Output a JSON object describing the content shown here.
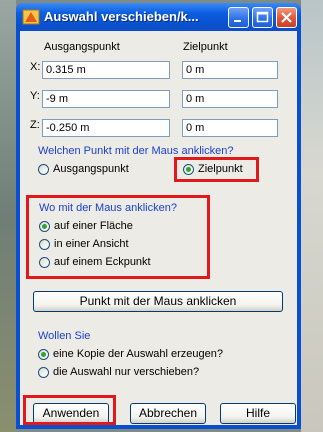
{
  "window": {
    "title": "Auswahl verschieben/k..."
  },
  "coords": {
    "header_start": "Ausgangspunkt",
    "header_target": "Zielpunkt",
    "rows": [
      {
        "axis": "X:",
        "start": "0.315 m",
        "target": "0 m"
      },
      {
        "axis": "Y:",
        "start": "-9 m",
        "target": "0 m"
      },
      {
        "axis": "Z:",
        "start": "-0.250 m",
        "target": "0 m"
      }
    ]
  },
  "which_point": {
    "question": "Welchen Punkt mit der Maus anklicken?",
    "options": [
      "Ausgangspunkt",
      "Zielpunkt"
    ],
    "selected": "Zielpunkt"
  },
  "where": {
    "question": "Wo mit der Maus anklicken?",
    "options": [
      "auf einer Fläche",
      "in einer Ansicht",
      "auf einem Eckpunkt"
    ],
    "selected": "auf einer Fläche"
  },
  "click_button": "Punkt mit der Maus anklicken",
  "want": {
    "question": "Wollen Sie",
    "options": [
      "eine Kopie der Auswahl erzeugen?",
      "die Auswahl nur verschieben?"
    ],
    "selected": "eine Kopie der Auswahl erzeugen?"
  },
  "buttons": {
    "apply": "Anwenden",
    "cancel": "Abbrechen",
    "help": "Hilfe"
  },
  "colors": {
    "title_bar": "#0a52d0",
    "highlight": "#e01a1a",
    "prompt_text": "#1a3fcf"
  }
}
